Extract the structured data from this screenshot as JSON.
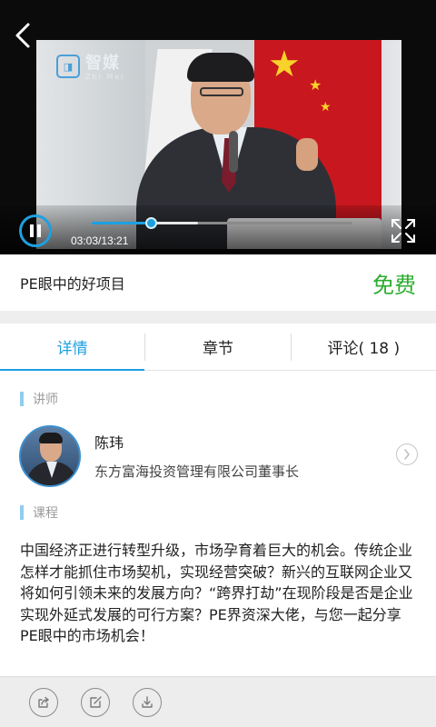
{
  "player": {
    "current_time": "03:03",
    "total_time": "13:21",
    "time_display": "03:03/13:21",
    "progress": 0.23,
    "buffered": 0.41,
    "watermark_name": "智媒",
    "watermark_sub": "Zhi Mei",
    "state": "playing",
    "accent_color": "#1e9fe0"
  },
  "course": {
    "title": "PE眼中的好项目",
    "price": "免费",
    "price_color": "#2cac2f"
  },
  "tabs": [
    {
      "label": "详情",
      "active": true
    },
    {
      "label": "章节",
      "active": false
    },
    {
      "label": "评论( 18 )",
      "active": false
    }
  ],
  "teacher_section": {
    "label": "讲师",
    "name": "陈玮",
    "title": "东方富海投资管理有限公司董事长"
  },
  "course_section": {
    "label": "课程",
    "description": "中国经济正进行转型升级，市场孕育着巨大的机会。传统企业怎样才能抓住市场契机，实现经营突破？新兴的互联网企业又将如何引领未来的发展方向？“跨界打劫”在现阶段是否是企业实现外延式发展的可行方案？PE界资深大佬，与您一起分享PE眼中的市场机会！"
  },
  "toolbar": {
    "icons": [
      "share-icon",
      "edit-note-icon",
      "download-icon"
    ]
  }
}
